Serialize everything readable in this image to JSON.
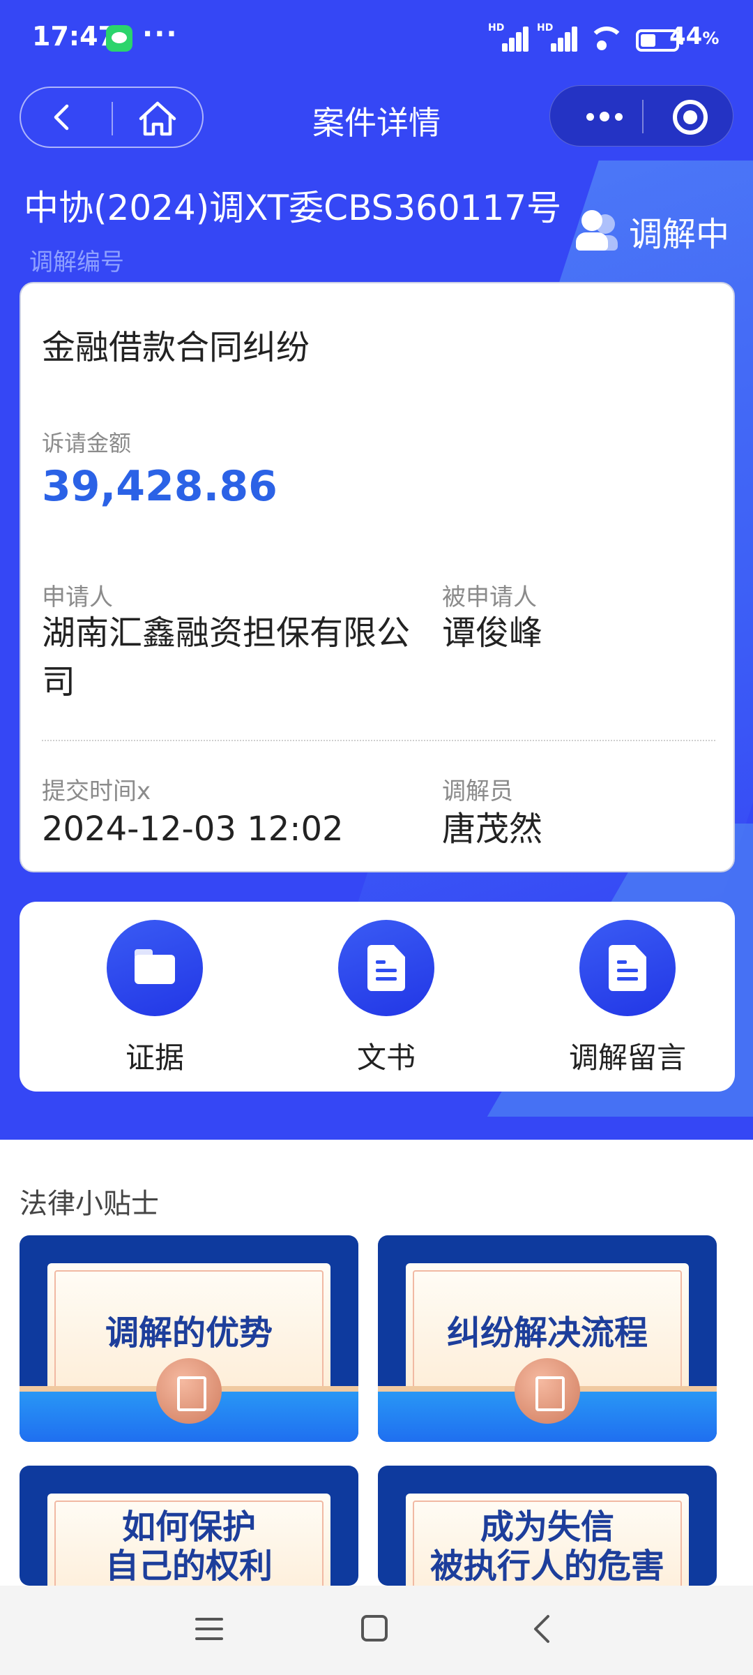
{
  "status_bar": {
    "time": "17:47",
    "more": "···",
    "battery_percent": "44",
    "battery_suffix": "%",
    "battery_level": 0.44,
    "icons": [
      "wechat-icon",
      "hd-signal-icon",
      "hd-signal-icon",
      "wifi-icon",
      "battery-icon"
    ],
    "hd_label": "HD"
  },
  "nav": {
    "title": "案件详情",
    "icons": [
      "back-icon",
      "home-icon",
      "more-icon",
      "target-icon"
    ]
  },
  "case": {
    "number": "中协(2024)调XT委CBS360117号",
    "number_label": "调解编号",
    "status": "调解中",
    "type": "金融借款合同纠纷",
    "claim_label": "诉请金额",
    "claim_amount": "39,428.86",
    "applicant_label": "申请人",
    "applicant": "湖南汇鑫融资担保有限公司",
    "respondent_label": "被申请人",
    "respondent": "谭俊峰",
    "submit_time_label": "提交时间x",
    "submit_time": "2024-12-03 12:02",
    "mediator_label": "调解员",
    "mediator": "唐茂然"
  },
  "actions": [
    {
      "label": "证据",
      "icon": "folder-icon"
    },
    {
      "label": "文书",
      "icon": "document-icon"
    },
    {
      "label": "调解留言",
      "icon": "document-icon"
    }
  ],
  "tips": {
    "title": "法律小贴士",
    "items": [
      {
        "text": "调解的优势"
      },
      {
        "text": "纠纷解决流程"
      },
      {
        "line1": "如何保护",
        "line2": "自己的权利"
      },
      {
        "line1": "成为失信",
        "line2": "被执行人的危害"
      }
    ]
  },
  "colors": {
    "primary": "#3547f5",
    "accent_amount": "#2b62e6",
    "tip_card": "#0e3a9e"
  }
}
